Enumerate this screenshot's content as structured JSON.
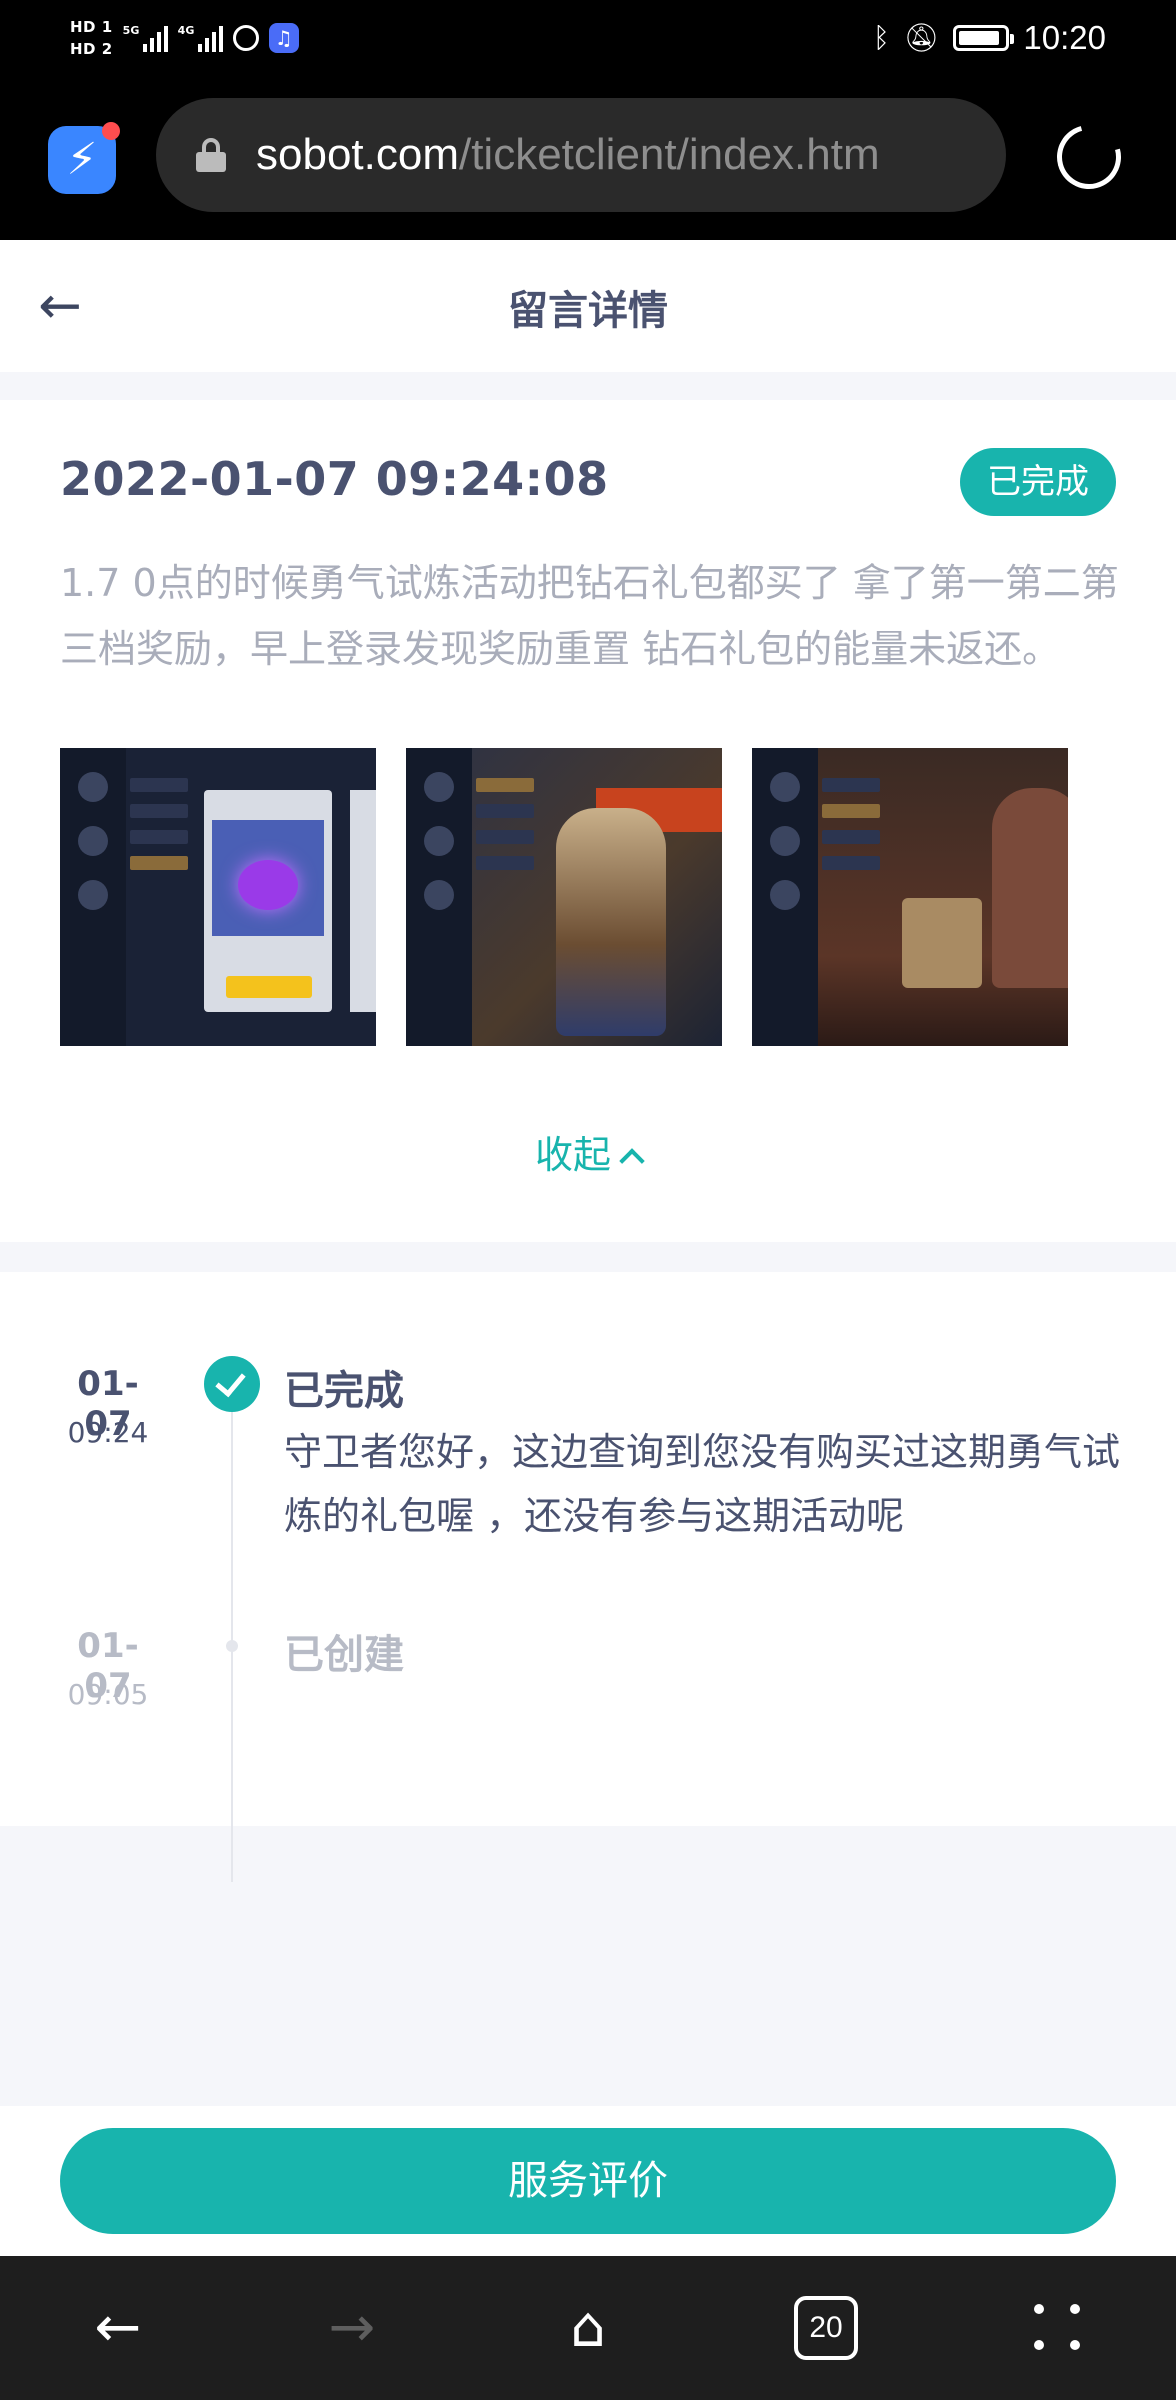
{
  "status_bar": {
    "hd1": "HD 1",
    "hd2": "HD 2",
    "net1": "5G",
    "net2": "4G",
    "time": "10:20"
  },
  "browser": {
    "url_domain": "sobot.com",
    "url_path": "/ticketclient/index.htm"
  },
  "header": {
    "title": "留言详情"
  },
  "ticket": {
    "created_at": "2022-01-07 09:24:08",
    "status": "已完成",
    "description": "1.7 0点的时候勇气试炼活动把钻石礼包都买了 拿了第一第二第三档奖励，早上登录发现奖励重置 钻石礼包的能量未返还。",
    "collapse_label": "收起"
  },
  "timeline": [
    {
      "date": "01-07",
      "time": "09:24",
      "status": "已完成",
      "text": "守卫者您好，这边查询到您没有购买过这期勇气试炼的礼包喔 ，还没有参与这期活动呢"
    },
    {
      "date": "01-07",
      "time": "09:05",
      "status": "已创建",
      "text": ""
    }
  ],
  "actions": {
    "rate_service": "服务评价"
  },
  "nav": {
    "tab_count": "20"
  },
  "colors": {
    "accent": "#18b4ad",
    "text_primary": "#4a5270",
    "text_muted": "#a9adba"
  }
}
